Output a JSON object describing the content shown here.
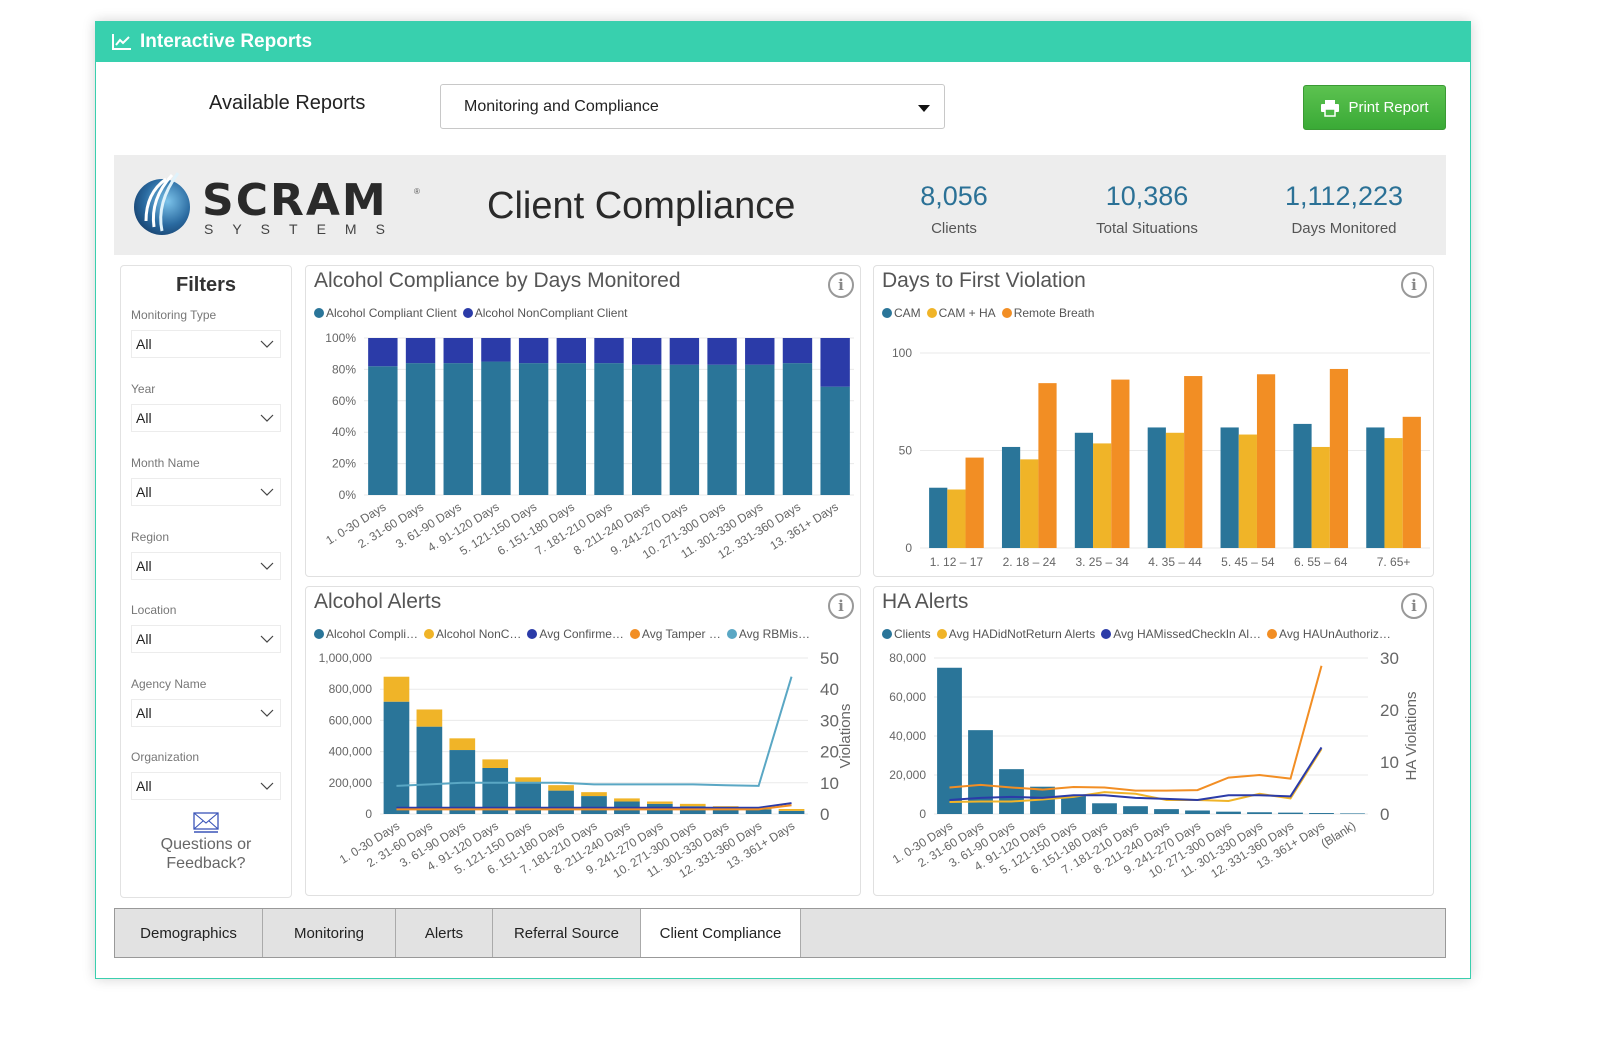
{
  "app": {
    "title": "Interactive Reports",
    "title_icon": "line-chart-icon"
  },
  "toolbar": {
    "available_reports_label": "Available Reports",
    "selected_report": "Monitoring and Compliance",
    "print_label": "Print Report",
    "print_icon": "printer-icon"
  },
  "header": {
    "logo_text": "SCRAM",
    "logo_sub": "SYSTEMS",
    "logo_reg": "®",
    "report_title": "Client Compliance",
    "kpis": [
      {
        "value": "8,056",
        "label": "Clients"
      },
      {
        "value": "10,386",
        "label": "Total Situations"
      },
      {
        "value": "1,112,223",
        "label": "Days Monitored"
      }
    ]
  },
  "filters": {
    "title": "Filters",
    "items": [
      {
        "label": "Monitoring Type",
        "value": "All"
      },
      {
        "label": "Year",
        "value": "All"
      },
      {
        "label": "Month Name",
        "value": "All"
      },
      {
        "label": "Region",
        "value": "All"
      },
      {
        "label": "Location",
        "value": "All"
      },
      {
        "label": "Agency Name",
        "value": "All"
      },
      {
        "label": "Organization",
        "value": "All"
      }
    ],
    "feedback_line1": "Questions or",
    "feedback_line2": "Feedback?"
  },
  "colors": {
    "teal_blue": "#2a7599",
    "navy": "#2b3ba8",
    "yellow": "#f0b428",
    "orange": "#f28e24",
    "light_blue": "#5aa7c4",
    "accent": "#38d0ae",
    "kpi": "#2b7196"
  },
  "tabs": [
    {
      "label": "Demographics",
      "active": false
    },
    {
      "label": "Monitoring",
      "active": false
    },
    {
      "label": "Alerts",
      "active": false
    },
    {
      "label": "Referral Source",
      "active": false
    },
    {
      "label": "Client Compliance",
      "active": true
    }
  ],
  "info_glyph": "i",
  "chart_data": [
    {
      "id": "compliance",
      "type": "bar",
      "stacked": "percent",
      "title": "Alcohol Compliance by Days Monitored",
      "categories": [
        "1. 0-30 Days",
        "2. 31-60 Days",
        "3. 61-90 Days",
        "4. 91-120 Days",
        "5. 121-150 Days",
        "6. 151-180 Days",
        "7. 181-210 Days",
        "8. 211-240 Days",
        "9. 241-270 Days",
        "10. 271-300 Days",
        "11. 301-330 Days",
        "12. 331-360 Days",
        "13. 361+ Days"
      ],
      "series": [
        {
          "name": "Alcohol Compliant Client",
          "color": "#2a7599",
          "values": [
            82,
            84,
            84,
            85,
            84,
            84,
            84,
            83,
            83,
            83,
            83,
            84,
            69
          ]
        },
        {
          "name": "Alcohol NonCompliant Client",
          "color": "#2b3ba8",
          "values": [
            18,
            16,
            16,
            15,
            16,
            16,
            16,
            17,
            17,
            17,
            17,
            16,
            31
          ]
        }
      ],
      "yticks": [
        "0%",
        "20%",
        "40%",
        "60%",
        "80%",
        "100%"
      ],
      "ylim": [
        0,
        100
      ],
      "legend": "top-left",
      "grid": true
    },
    {
      "id": "first_violation",
      "type": "bar",
      "title": "Days to First Violation",
      "categories": [
        "1. 12 – 17",
        "2. 18 – 24",
        "3. 25 – 34",
        "4. 35 – 44",
        "5. 45 – 54",
        "6. 55 – 64",
        "7. 65+"
      ],
      "series": [
        {
          "name": "CAM",
          "color": "#2a7599",
          "values": [
            34,
            57,
            65,
            68,
            68,
            70,
            68
          ]
        },
        {
          "name": "CAM + HA",
          "color": "#f0b428",
          "values": [
            33,
            50,
            59,
            65,
            64,
            57,
            62
          ]
        },
        {
          "name": "Remote Breath",
          "color": "#f28e24",
          "values": [
            51,
            93,
            95,
            97,
            98,
            101,
            74
          ]
        }
      ],
      "yticks": [
        "0",
        "50",
        "100"
      ],
      "ylim": [
        0,
        110
      ],
      "legend": "top-left",
      "grid": true
    },
    {
      "id": "alcohol_alerts",
      "type": "bar",
      "stacked": true,
      "title": "Alcohol Alerts",
      "categories": [
        "1. 0-30 Days",
        "2. 31-60 Days",
        "3. 61-90 Days",
        "4. 91-120 Days",
        "5. 121-150 Days",
        "6. 151-180 Days",
        "7. 181-210 Days",
        "8. 211-240 Days",
        "9. 241-270 Days",
        "10. 271-300 Days",
        "11. 301-330 Days",
        "12. 331-360 Days",
        "13. 361+ Days"
      ],
      "series": [
        {
          "name": "Alcohol Compli…",
          "color": "#2a7599",
          "values": [
            720000,
            560000,
            410000,
            295000,
            200000,
            150000,
            115000,
            80000,
            65000,
            50000,
            40000,
            30000,
            20000
          ]
        },
        {
          "name": "Alcohol NonC…",
          "color": "#f0b428",
          "values": [
            160000,
            110000,
            75000,
            55000,
            35000,
            35000,
            25000,
            20000,
            15000,
            15000,
            10000,
            8000,
            12000
          ]
        }
      ],
      "line_series": [
        {
          "name": "Avg Confirme…",
          "color": "#2b3ba8",
          "values": [
            2,
            2,
            2,
            2,
            2,
            2,
            2,
            2,
            2,
            2,
            2,
            2,
            3.5
          ]
        },
        {
          "name": "Avg Tamper …",
          "color": "#f28e24",
          "values": [
            1.5,
            1.5,
            1.5,
            1.5,
            1.5,
            1.5,
            1.5,
            1.5,
            1.5,
            1.5,
            1.5,
            1.5,
            2.8
          ]
        },
        {
          "name": "Avg RBMis…",
          "color": "#5aa7c4",
          "values": [
            9,
            9.5,
            10,
            10,
            10,
            10,
            9.5,
            9.5,
            9.5,
            9.5,
            9.2,
            9,
            44
          ]
        }
      ],
      "yticks": [
        "0",
        "200,000",
        "400,000",
        "600,000",
        "800,000",
        "1,000,000"
      ],
      "ylim": [
        0,
        1000000
      ],
      "y2ticks": [
        "0",
        "10",
        "20",
        "30",
        "40",
        "50"
      ],
      "y2lim": [
        0,
        50
      ],
      "y2label": "Violations",
      "legend": "top-left",
      "grid": true
    },
    {
      "id": "ha_alerts",
      "type": "bar",
      "title": "HA Alerts",
      "categories": [
        "1. 0-30 Days",
        "2. 31-60 Days",
        "3. 61-90 Days",
        "4. 91-120 Days",
        "5. 121-150 Days",
        "6. 151-180 Days",
        "7. 181-210 Days",
        "8. 211-240 Days",
        "9. 241-270 Days",
        "10. 271-300 Days",
        "11. 301-330 Days",
        "12. 331-360 Days",
        "13. 361+ Days",
        "(Blank)"
      ],
      "series": [
        {
          "name": "Clients",
          "color": "#2a7599",
          "values": [
            75000,
            43000,
            23000,
            14000,
            9500,
            5500,
            4000,
            2500,
            1800,
            1200,
            900,
            700,
            500,
            300
          ]
        }
      ],
      "line_series": [
        {
          "name": "Avg HADidNotReturn Alerts",
          "color": "#f0b428",
          "values": [
            2.3,
            2.4,
            2.4,
            2.8,
            3.3,
            4.2,
            3.9,
            2.7,
            2.7,
            2.5,
            3.9,
            3,
            12.5
          ]
        },
        {
          "name": "Avg HAMissedCheckIn Al…",
          "color": "#2b3ba8",
          "values": [
            2.7,
            3.1,
            3.3,
            3.1,
            3.6,
            3.6,
            3.1,
            2.9,
            2.7,
            3.6,
            3.6,
            3.4,
            12.8
          ]
        },
        {
          "name": "Avg HAUnAuthoriz…",
          "color": "#f28e24",
          "values": [
            5.1,
            5.6,
            5.1,
            4.7,
            5.2,
            5.1,
            4.5,
            4.5,
            4.6,
            7,
            7.5,
            6.8,
            28.5
          ]
        }
      ],
      "yticks": [
        "0",
        "20,000",
        "40,000",
        "60,000",
        "80,000"
      ],
      "ylim": [
        0,
        80000
      ],
      "y2ticks": [
        "0",
        "10",
        "20",
        "30"
      ],
      "y2lim": [
        0,
        30
      ],
      "y2label": "HA Violations",
      "legend": "top-left",
      "grid": true
    }
  ]
}
